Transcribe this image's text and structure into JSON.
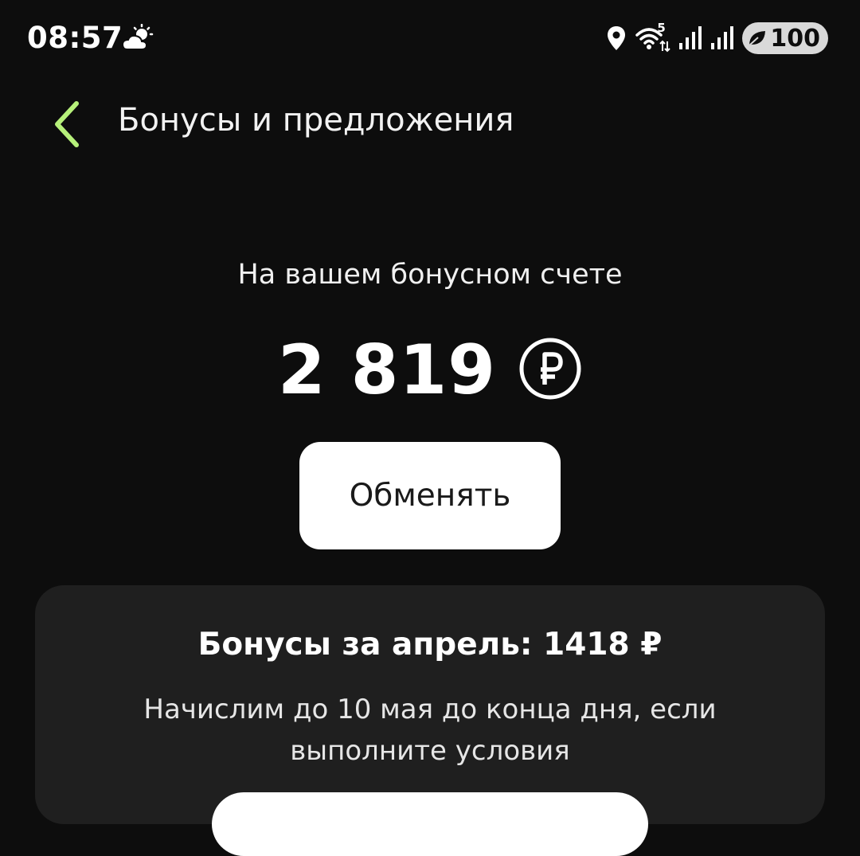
{
  "status_bar": {
    "time": "08:57",
    "weather_icon": "partly-cloudy-icon",
    "network_badge": "5",
    "battery": "100"
  },
  "header": {
    "title": "Бонусы и предложения",
    "back_icon": "chevron-left-icon",
    "accent_color": "#b6f07a"
  },
  "balance": {
    "caption": "На вашем бонусном счете",
    "amount": "2 819",
    "currency_icon": "ruble-circle-icon",
    "exchange_label": "Обменять"
  },
  "bonus_card": {
    "title": "Бонусы за апрель: 1418 ₽",
    "text": "Начислим до 10 мая до конца дня, если выполните условия"
  }
}
